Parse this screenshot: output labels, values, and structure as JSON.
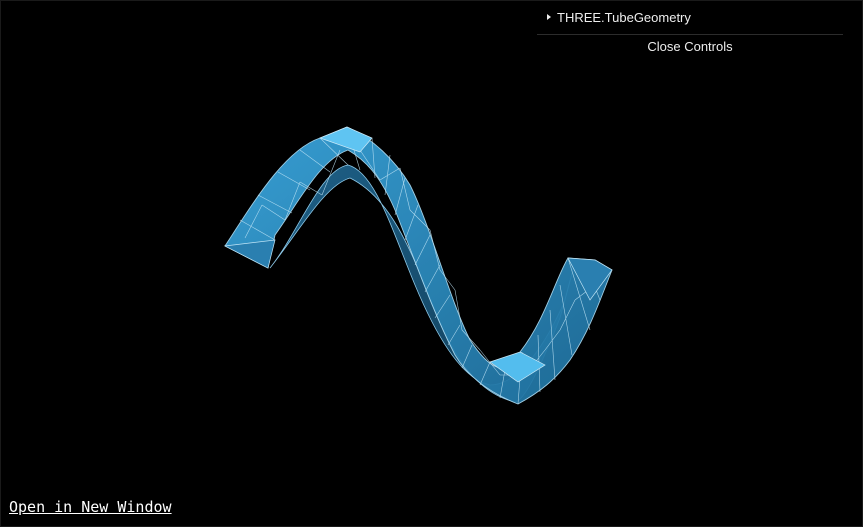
{
  "gui": {
    "folder_label": "THREE.TubeGeometry",
    "close_label": "Close Controls"
  },
  "footer": {
    "open_link": "Open in New Window"
  },
  "colors": {
    "background": "#000000",
    "tube_fill": "#2f8fc4",
    "tube_wire": "#a8d8f0"
  },
  "icons": {
    "folder_caret": "caret-right-icon"
  }
}
